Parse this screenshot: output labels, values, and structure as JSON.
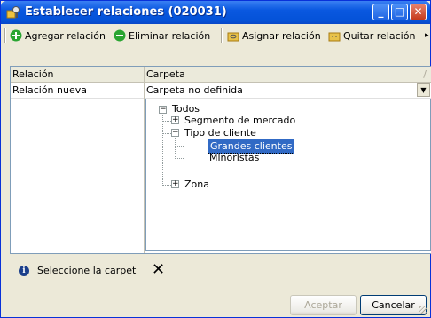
{
  "window": {
    "title": "Establecer relaciones (020031)",
    "controls": {
      "minimize": "_",
      "maximize": "□",
      "close": "✕"
    }
  },
  "toolbar": {
    "add_label": "Agregar relación",
    "remove_label": "Eliminar relación",
    "assign_label": "Asignar relación",
    "unassign_label": "Quitar relación"
  },
  "grid": {
    "columns": [
      "Relación",
      "Carpeta"
    ],
    "sort_indicator": "/",
    "rows": [
      {
        "relacion": "Relación nueva",
        "carpeta": "Carpeta no definida"
      }
    ]
  },
  "tree": {
    "root": "Todos",
    "items": [
      {
        "label": "Segmento de mercado",
        "state": "collapsed"
      },
      {
        "label": "Tipo de cliente",
        "state": "expanded",
        "children": [
          {
            "label": "Grandes clientes",
            "selected": true
          },
          {
            "label": "Minoristas"
          }
        ]
      },
      {
        "label": "Zona",
        "state": "collapsed"
      }
    ]
  },
  "status": {
    "message": "Seleccione la carpet",
    "close_glyph": "✕"
  },
  "buttons": {
    "accept": "Aceptar",
    "cancel": "Cancelar"
  },
  "colors": {
    "titlebar": "#0a58e0",
    "selection": "#316ac5",
    "add_icon": "#2aa532",
    "remove_icon": "#2aa532",
    "folder_icon": "#e8c24a"
  }
}
